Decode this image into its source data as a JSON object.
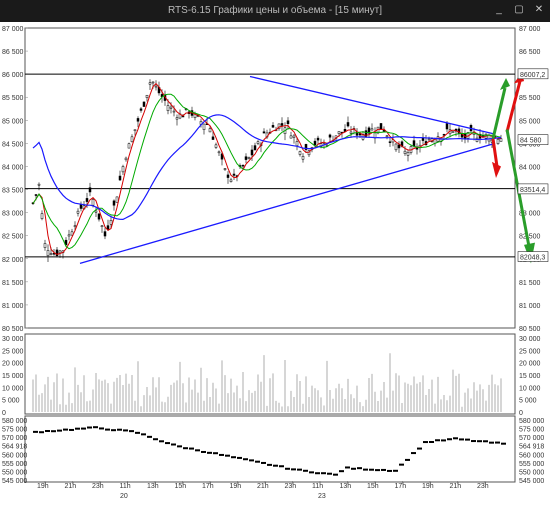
{
  "window": {
    "title": "RTS-6.15 Графики цены и объема - [15 минут]"
  },
  "icons": {
    "minimize": "minimize-icon",
    "maximize": "maximize-icon",
    "close": "close-icon"
  },
  "colors": {
    "up_candle": "#ffffff",
    "down_candle": "#000000",
    "ma_fast": "#d40000",
    "ma_mid": "#00aa00",
    "ma_slow": "#1a1aff",
    "trendline": "#1a1aff",
    "arrow_green": "#2a9d2a",
    "arrow_red": "#e01010"
  },
  "chart_data": [
    {
      "type": "candlestick",
      "panel": "price",
      "y_ticks": [
        "87 000",
        "86 500",
        "86 000",
        "85 500",
        "85 000",
        "84 500",
        "84 000",
        "83 500",
        "83 000",
        "82 500",
        "82 000",
        "81 500",
        "81 000",
        "80 500"
      ],
      "ylim": [
        80500,
        87000
      ],
      "price_labels": [
        {
          "text": "86007,2",
          "value": 86007,
          "color": "#e01010"
        },
        {
          "text": "84 580",
          "value": 84580,
          "color": "#ffffff"
        },
        {
          "text": "83514,4",
          "value": 83514,
          "color": "#ffffff"
        },
        {
          "text": "82048,3",
          "value": 82048,
          "color": "#ffffff"
        }
      ],
      "horizontal_levels": [
        86000,
        83520,
        82040
      ],
      "trendlines": [
        {
          "from": [
            "19h-20",
            "81900"
          ],
          "to": [
            "23h-23",
            "84500"
          ]
        },
        {
          "from": [
            "19h-20",
            "85950"
          ],
          "to": [
            "23h-23",
            "84700"
          ]
        }
      ]
    },
    {
      "type": "bar",
      "panel": "volume",
      "y_ticks": [
        "30 000",
        "25 000",
        "20 000",
        "15 000",
        "10 000",
        "5 000",
        "0"
      ],
      "ylim": [
        0,
        30000
      ]
    },
    {
      "type": "line",
      "panel": "open-interest",
      "y_ticks": [
        "580 000",
        "575 000",
        "570 000",
        "564 918",
        "560 000",
        "555 000",
        "550 000",
        "545 000"
      ],
      "ylim": [
        545000,
        580000
      ]
    }
  ],
  "time_axis": {
    "left_ticks": [
      "19h",
      "21h",
      "23h",
      "11h",
      "13h",
      "15h",
      "17h",
      "19h",
      "21h",
      "23h",
      "11h",
      "13h",
      "15h",
      "17h",
      "19h",
      "21h",
      "23h"
    ],
    "dates": [
      "20",
      "23"
    ]
  }
}
